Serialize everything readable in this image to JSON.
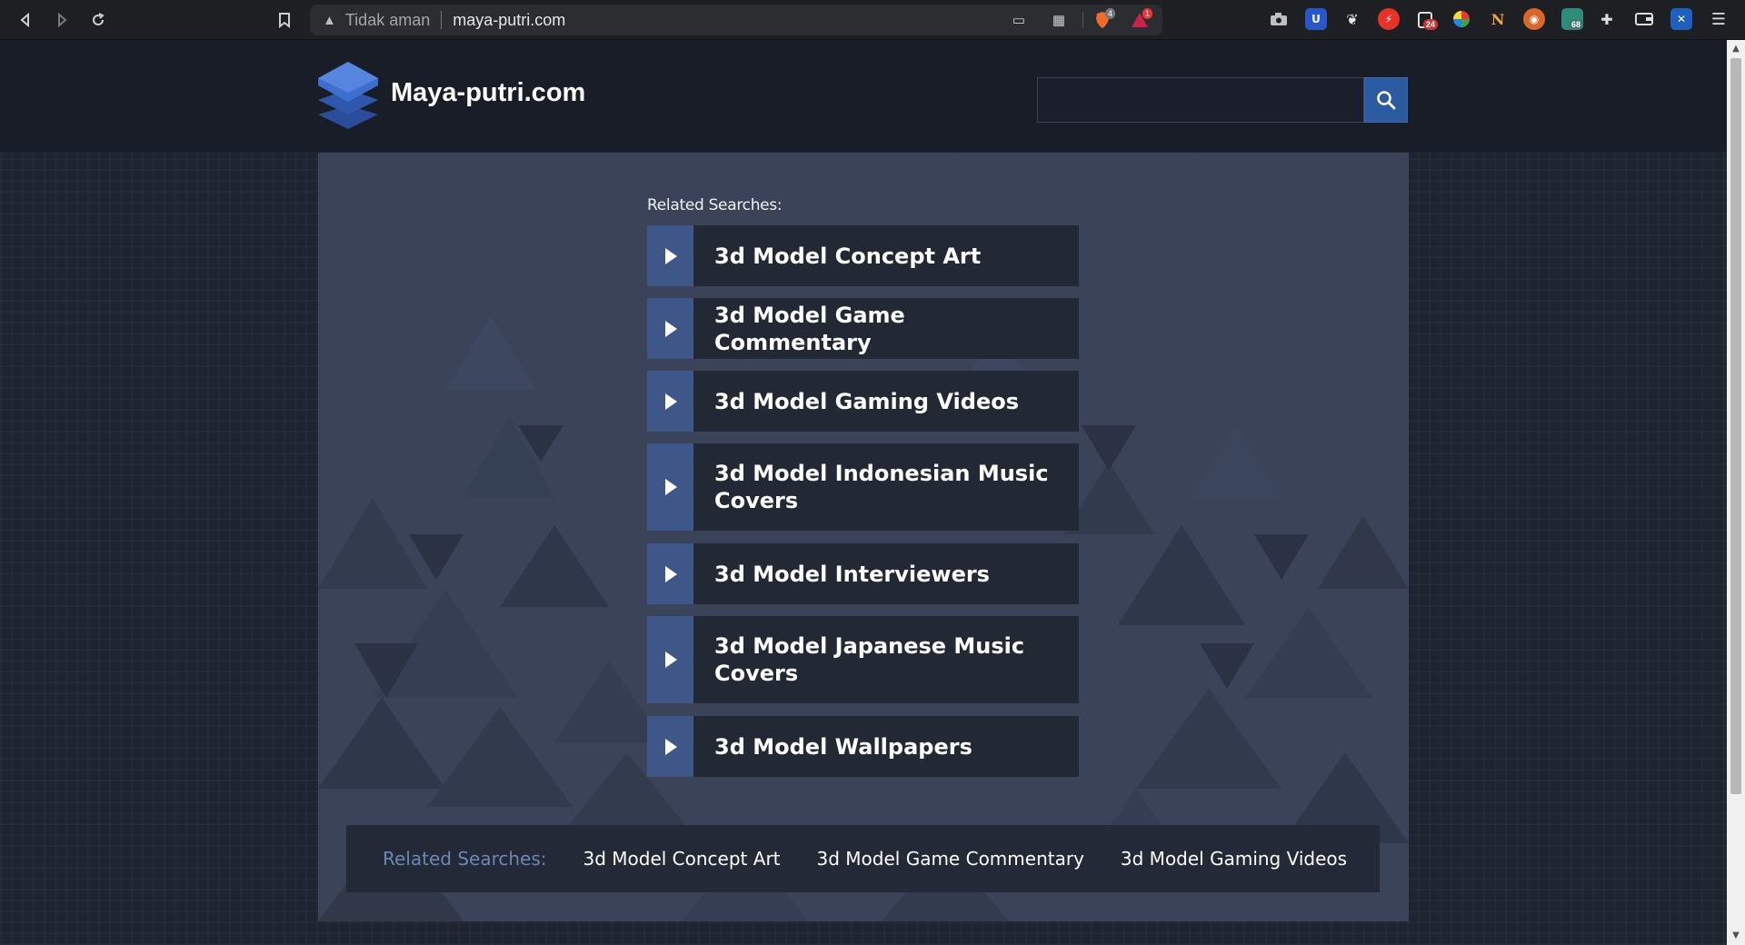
{
  "browser": {
    "security_label": "Tidak aman",
    "url": "maya-putri.com",
    "brave_shield_count": "4",
    "rewards_count": "1",
    "ext_badge_1": "24",
    "ext_badge_2": "68"
  },
  "site": {
    "name": "Maya-putri.com",
    "search_placeholder": ""
  },
  "related": {
    "title": "Related Searches:",
    "items": [
      {
        "label": "3d Model Concept Art"
      },
      {
        "label": "3d Model Game Commentary"
      },
      {
        "label": "3d Model Gaming Videos"
      },
      {
        "label": "3d Model Indonesian Music Covers"
      },
      {
        "label": "3d Model Interviewers"
      },
      {
        "label": "3d Model Japanese Music Covers"
      },
      {
        "label": "3d Model Wallpapers"
      }
    ]
  },
  "footer": {
    "title": "Related Searches:",
    "links": [
      {
        "label": "3d Model Concept Art"
      },
      {
        "label": "3d Model Game Commentary"
      },
      {
        "label": "3d Model Gaming Videos"
      }
    ]
  },
  "colors": {
    "header_bg": "#181d28",
    "content_bg": "#3a4358",
    "accent": "#3f5788",
    "search_button": "#2c5aa0",
    "footer_title": "#6e86b3"
  }
}
